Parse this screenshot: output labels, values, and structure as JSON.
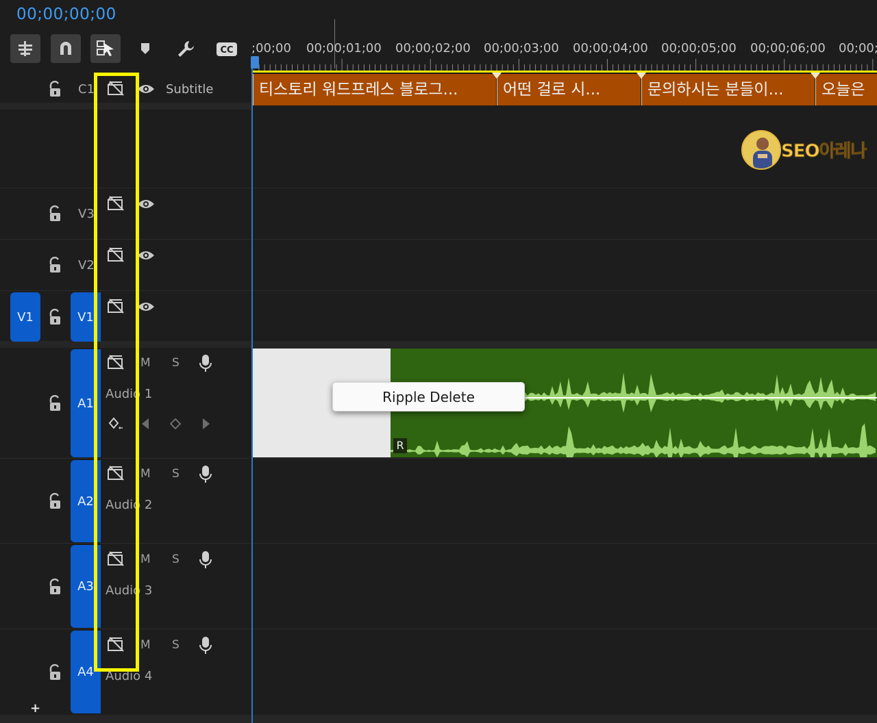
{
  "timecode": "00;00;00;00",
  "toolbar": {
    "buttons": [
      "insert-nest-icon",
      "snap-magnet-icon",
      "linked-selection-icon",
      "marker-icon",
      "wrench-icon",
      "captions-icon"
    ],
    "cc_label": "CC"
  },
  "ruler": {
    "labels": [
      ";00;00",
      "00;00;01;00",
      "00;00;02;00",
      "00;00;03;00",
      "00;00;04;00",
      "00;00;05;00",
      "00;00;06;00",
      "00;00;"
    ]
  },
  "caption_track": {
    "label": "C1",
    "name": "Subtitle",
    "clips": [
      "티스토리 워드프레스 블로그...",
      "어떤 걸로 시...",
      "문의하시는 분들이...",
      "오늘은"
    ]
  },
  "video_tracks": [
    {
      "id": "V3",
      "label": "V3"
    },
    {
      "id": "V2",
      "label": "V2"
    },
    {
      "id": "V1",
      "label": "V1",
      "source_label": "V1"
    }
  ],
  "audio_tracks": [
    {
      "id": "A1",
      "label": "A1",
      "name": "Audio 1",
      "mute": "M",
      "solo": "S"
    },
    {
      "id": "A2",
      "label": "A2",
      "name": "Audio 2",
      "mute": "M",
      "solo": "S"
    },
    {
      "id": "A3",
      "label": "A3",
      "name": "Audio 3",
      "mute": "M",
      "solo": "S"
    },
    {
      "id": "A4",
      "label": "A4",
      "name": "Audio 4",
      "mute": "M",
      "solo": "S"
    }
  ],
  "audio_clip": {
    "badge": "R"
  },
  "context_menu": {
    "item": "Ripple Delete"
  },
  "watermark": {
    "text": "SEO아레나"
  },
  "add_track": "+",
  "colors": {
    "accent_blue": "#0c5ccc",
    "timecode_blue": "#3f9cf5",
    "caption_clip": "#a84a00",
    "audio_clip_bg": "#2f6410",
    "waveform": "#9bd36e",
    "highlight": "#f6f400"
  }
}
